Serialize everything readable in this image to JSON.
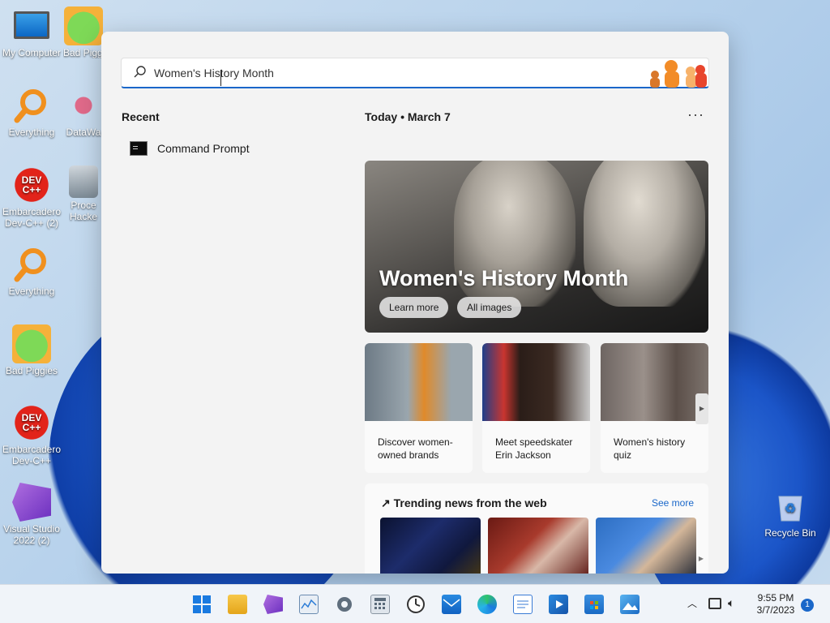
{
  "desktop": {
    "icons": [
      {
        "label": "My Computer",
        "icon": "computer-icon"
      },
      {
        "label": "Bad Piggies",
        "icon": "bad-piggies-icon"
      },
      {
        "label": "Everything",
        "icon": "everything-icon"
      },
      {
        "label": "DataWa",
        "icon": "datawarehouse-icon"
      },
      {
        "label": "Embarcadero Dev-C++ (2)",
        "icon": "devcpp-icon"
      },
      {
        "label": "Proce Hacke",
        "icon": "process-hacker-icon"
      },
      {
        "label": "Everything",
        "icon": "everything-icon"
      },
      {
        "label": "Bad Piggies",
        "icon": "bad-piggies-icon"
      },
      {
        "label": "Embarcadero Dev-C++",
        "icon": "devcpp-icon"
      },
      {
        "label": "Visual Studio 2022 (2)",
        "icon": "visual-studio-icon"
      },
      {
        "label": "Recycle Bin",
        "icon": "recycle-bin-icon"
      }
    ],
    "devcpp_glyph": "DEV C++"
  },
  "search": {
    "value": "Women's History Month",
    "accent": "#1a67c9"
  },
  "recent": {
    "title": "Recent",
    "items": [
      {
        "label": "Command Prompt",
        "icon": "command-prompt-icon"
      }
    ]
  },
  "today": {
    "label": "Today • March 7",
    "more": "···"
  },
  "hero": {
    "title": "Women's History Month",
    "buttons": [
      "Learn more",
      "All images"
    ]
  },
  "cards": [
    {
      "caption": "Discover women-owned brands"
    },
    {
      "caption": "Meet speedskater Erin Jackson"
    },
    {
      "caption": "Women's history quiz"
    }
  ],
  "trending": {
    "title": "↗ Trending news from the web",
    "see_more": "See more"
  },
  "taskbar": {
    "apps": [
      "start-icon",
      "file-explorer-icon",
      "visual-studio-icon",
      "task-manager-icon",
      "settings-icon",
      "calculator-icon",
      "clock-icon",
      "mail-icon",
      "edge-icon",
      "notepad-icon",
      "media-player-icon",
      "store-icon",
      "photos-icon"
    ],
    "time": "9:55 PM",
    "date": "3/7/2023",
    "notifications": "1"
  }
}
